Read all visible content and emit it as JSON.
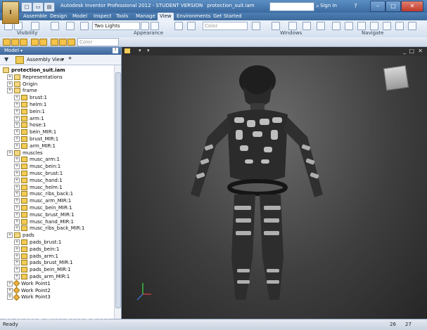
{
  "window": {
    "title_app": "Autodesk Inventor Professional 2012 - STUDENT VERSION",
    "title_file": "protection_suit.iam",
    "search_placeholder": "",
    "sign_in": "Sign In"
  },
  "tabs": [
    "Assemble",
    "Design",
    "Model",
    "Inspect",
    "Tools",
    "Manage",
    "View",
    "Environments",
    "Get Started"
  ],
  "active_tab": "View",
  "ribbon": {
    "lighting": "Two Lights",
    "color": "Color",
    "panels": [
      "Visibility",
      "Appearance",
      "Windows",
      "Navigate"
    ]
  },
  "quick_toolbar": {
    "material_combo": "Color"
  },
  "browser": {
    "header": "Model",
    "view_mode": "Assembly View",
    "help": "?",
    "root": "protection_suit.iam",
    "items": [
      {
        "label": "Representations",
        "level": 1,
        "type": "folder"
      },
      {
        "label": "Origin",
        "level": 1,
        "type": "folder"
      },
      {
        "label": "frame",
        "level": 1,
        "type": "folder"
      },
      {
        "label": "brust:1",
        "level": 2,
        "type": "part"
      },
      {
        "label": "helm:1",
        "level": 2,
        "type": "part"
      },
      {
        "label": "bein:1",
        "level": 2,
        "type": "part"
      },
      {
        "label": "arm:1",
        "level": 2,
        "type": "part"
      },
      {
        "label": "hose:1",
        "level": 2,
        "type": "part"
      },
      {
        "label": "bein_MIR:1",
        "level": 2,
        "type": "part"
      },
      {
        "label": "brust_MIR:1",
        "level": 2,
        "type": "part"
      },
      {
        "label": "arm_MIR:1",
        "level": 2,
        "type": "part"
      },
      {
        "label": "muscles",
        "level": 1,
        "type": "folder"
      },
      {
        "label": "musc_arm:1",
        "level": 2,
        "type": "part"
      },
      {
        "label": "musc_bein:1",
        "level": 2,
        "type": "part"
      },
      {
        "label": "musc_brust:1",
        "level": 2,
        "type": "part"
      },
      {
        "label": "musc_hand:1",
        "level": 2,
        "type": "part"
      },
      {
        "label": "musc_helm:1",
        "level": 2,
        "type": "part"
      },
      {
        "label": "musc_ribs_back:1",
        "level": 2,
        "type": "part"
      },
      {
        "label": "musc_arm_MIR:1",
        "level": 2,
        "type": "part"
      },
      {
        "label": "musc_bein_MIR:1",
        "level": 2,
        "type": "part"
      },
      {
        "label": "musc_brust_MIR:1",
        "level": 2,
        "type": "part"
      },
      {
        "label": "musc_hand_MIR:1",
        "level": 2,
        "type": "part"
      },
      {
        "label": "musc_ribs_back_MIR:1",
        "level": 2,
        "type": "part"
      },
      {
        "label": "pads",
        "level": 1,
        "type": "folder"
      },
      {
        "label": "pads_brust:1",
        "level": 2,
        "type": "part"
      },
      {
        "label": "pads_bein:1",
        "level": 2,
        "type": "part"
      },
      {
        "label": "pads_arm:1",
        "level": 2,
        "type": "part"
      },
      {
        "label": "pads_brust_MIR:1",
        "level": 2,
        "type": "part"
      },
      {
        "label": "pads_bein_MIR:1",
        "level": 2,
        "type": "part"
      },
      {
        "label": "pads_arm_MIR:1",
        "level": 2,
        "type": "part"
      },
      {
        "label": "Work Point1",
        "level": 1,
        "type": "workpoint"
      },
      {
        "label": "Work Point2",
        "level": 1,
        "type": "workpoint"
      },
      {
        "label": "Work Point3",
        "level": 1,
        "type": "workpoint"
      }
    ]
  },
  "status": {
    "left": "Ready",
    "count_a": "26",
    "count_b": "27"
  },
  "watermark": "www.3dmox.com"
}
